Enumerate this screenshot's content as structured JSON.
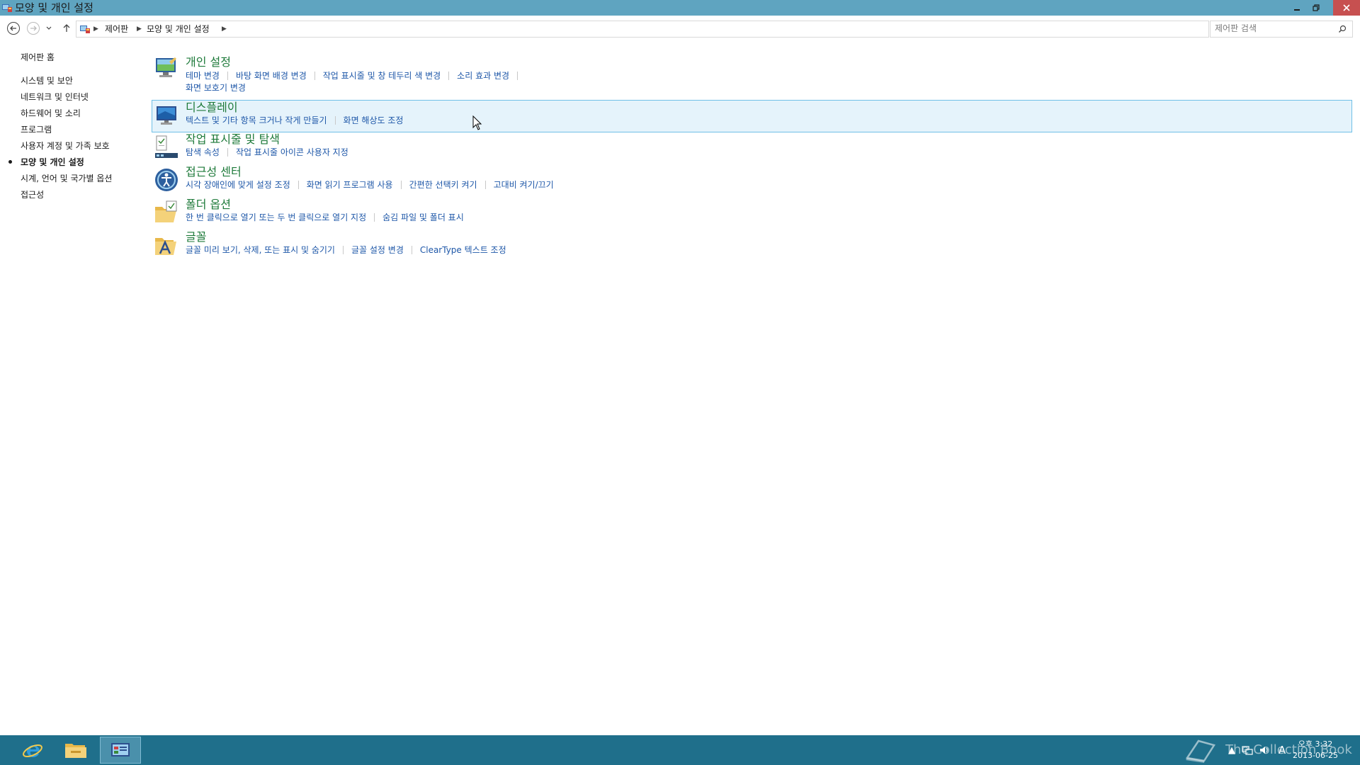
{
  "window": {
    "title": "모양 및 개인 설정",
    "minimize_icon": "minimize-icon",
    "restore_icon": "restore-icon",
    "close_icon": "close-icon"
  },
  "nav": {
    "breadcrumbs": [
      "제어판",
      "모양 및 개인 설정"
    ],
    "search_placeholder": "제어판 검색"
  },
  "sidebar": {
    "home": "제어판 홈",
    "items": [
      {
        "label": "시스템 및 보안",
        "active": false
      },
      {
        "label": "네트워크 및 인터넷",
        "active": false
      },
      {
        "label": "하드웨어 및 소리",
        "active": false
      },
      {
        "label": "프로그램",
        "active": false
      },
      {
        "label": "사용자 계정 및 가족 보호",
        "active": false
      },
      {
        "label": "모양 및 개인 설정",
        "active": true
      },
      {
        "label": "시계, 언어 및 국가별 옵션",
        "active": false
      },
      {
        "label": "접근성",
        "active": false
      }
    ]
  },
  "categories": [
    {
      "title": "개인 설정",
      "icon": "personalization-icon",
      "links": [
        "테마 변경",
        "바탕 화면 배경 변경",
        "작업 표시줄 및 창 테두리 색 변경",
        "소리 효과 변경",
        "화면 보호기 변경"
      ]
    },
    {
      "title": "디스플레이",
      "icon": "display-icon",
      "links": [
        "텍스트 및 기타 항목 크거나 작게 만들기",
        "화면 해상도 조정"
      ]
    },
    {
      "title": "작업 표시줄 및 탐색",
      "icon": "taskbar-navigation-icon",
      "links": [
        "탐색 속성",
        "작업 표시줄 아이콘 사용자 지정"
      ]
    },
    {
      "title": "접근성 센터",
      "icon": "ease-of-access-icon",
      "links": [
        "시각 장애인에 맞게 설정 조정",
        "화면 읽기 프로그램 사용",
        "간편한 선택키 켜기",
        "고대비 켜기/끄기"
      ]
    },
    {
      "title": "폴더 옵션",
      "icon": "folder-options-icon",
      "links": [
        "한 번 클릭으로 열기 또는 두 번 클릭으로 열기 지정",
        "숨김 파일 및 폴더 표시"
      ]
    },
    {
      "title": "글꼴",
      "icon": "fonts-icon",
      "links": [
        "글꼴 미리 보기, 삭제, 또는 표시 및 숨기기",
        "글꼴 설정 변경",
        "ClearType 텍스트 조정"
      ]
    }
  ],
  "taskbar": {
    "apps": [
      "internet-explorer-icon",
      "file-explorer-icon",
      "control-panel-icon"
    ],
    "clock_time": "오후 3:32",
    "clock_date": "2013-06-25",
    "ime": "A",
    "watermark": "The Collection Book"
  }
}
